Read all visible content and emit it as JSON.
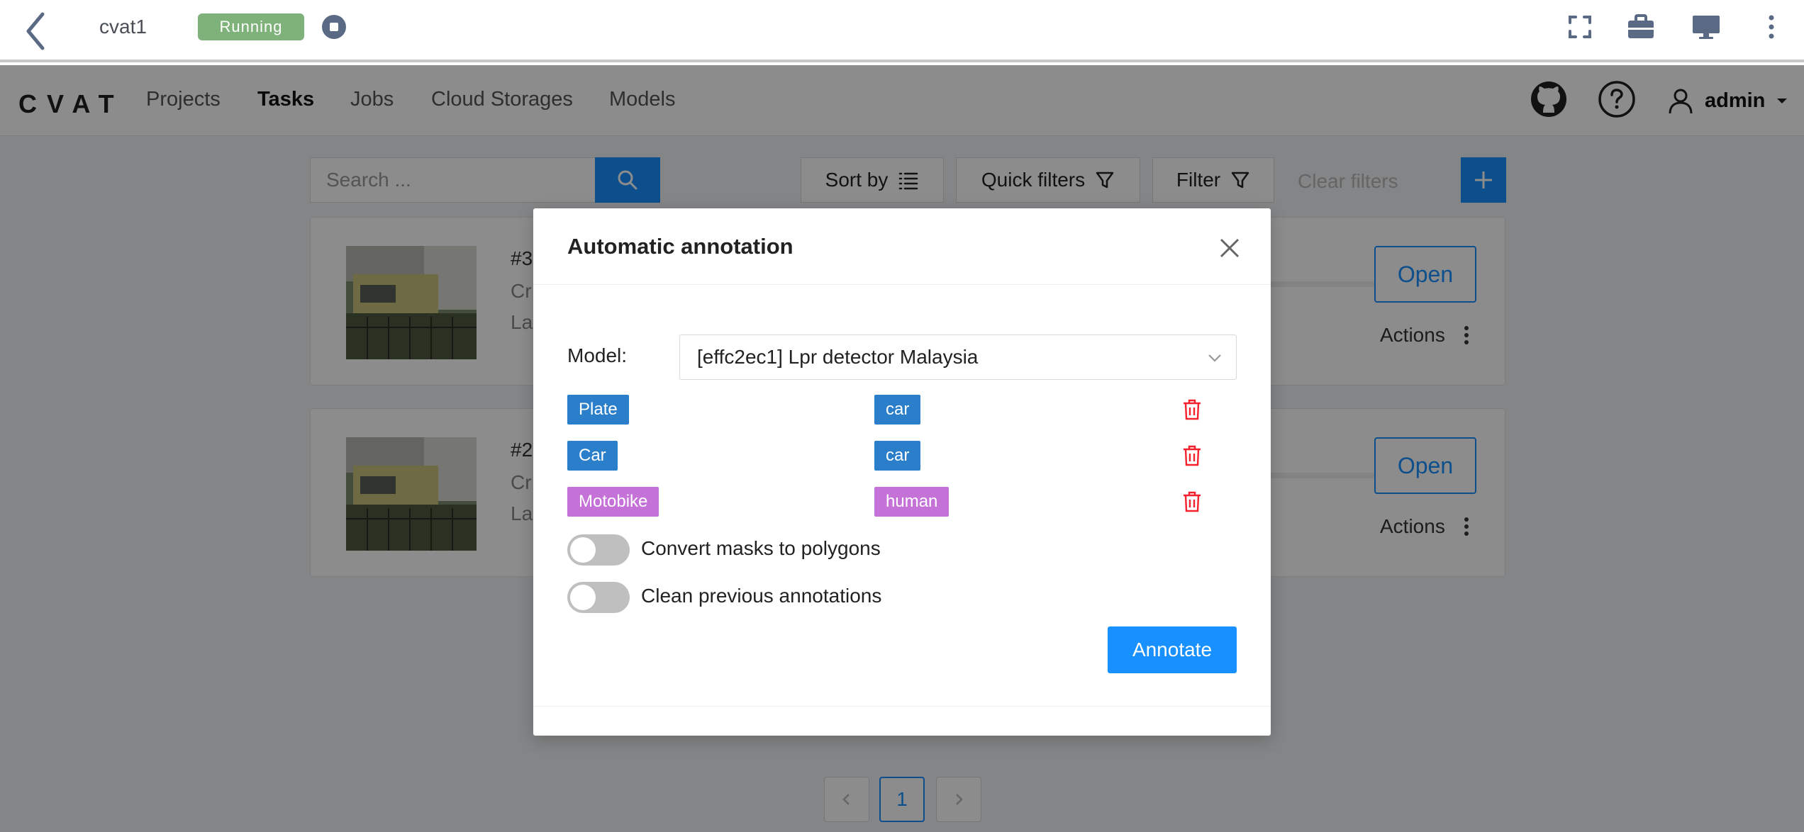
{
  "hostbar": {
    "vm_name": "cvat1",
    "status": "Running",
    "status_color": "#7fb27a"
  },
  "nav": {
    "logo": "CVAT",
    "links": [
      "Projects",
      "Tasks",
      "Jobs",
      "Cloud Storages",
      "Models"
    ],
    "active": "Tasks",
    "user": "admin"
  },
  "toolbar": {
    "search_placeholder": "Search ...",
    "sort_label": "Sort by",
    "quick_filters_label": "Quick filters",
    "filter_label": "Filter",
    "clear_filters_label": "Clear filters"
  },
  "tasks": [
    {
      "id_text": "#3",
      "line1": "Cr",
      "line2": "La",
      "open_label": "Open",
      "actions_label": "Actions"
    },
    {
      "id_text": "#2",
      "line1": "Cr",
      "line2": "La",
      "open_label": "Open",
      "actions_label": "Actions"
    }
  ],
  "pagination": {
    "current": "1"
  },
  "modal": {
    "title": "Automatic annotation",
    "model_label": "Model:",
    "model_value": "[effc2ec1] Lpr detector Malaysia",
    "mappings": [
      {
        "model_label": "Plate",
        "task_label": "car",
        "color": "#2b7fca"
      },
      {
        "model_label": "Car",
        "task_label": "car",
        "color": "#2b7fca"
      },
      {
        "model_label": "Motobike",
        "task_label": "human",
        "color": "#c471d8"
      }
    ],
    "convert_masks_label": "Convert masks to polygons",
    "clean_previous_label": "Clean previous annotations",
    "annotate_label": "Annotate"
  },
  "colors": {
    "accent": "#1890ff",
    "danger": "#f5222d"
  }
}
